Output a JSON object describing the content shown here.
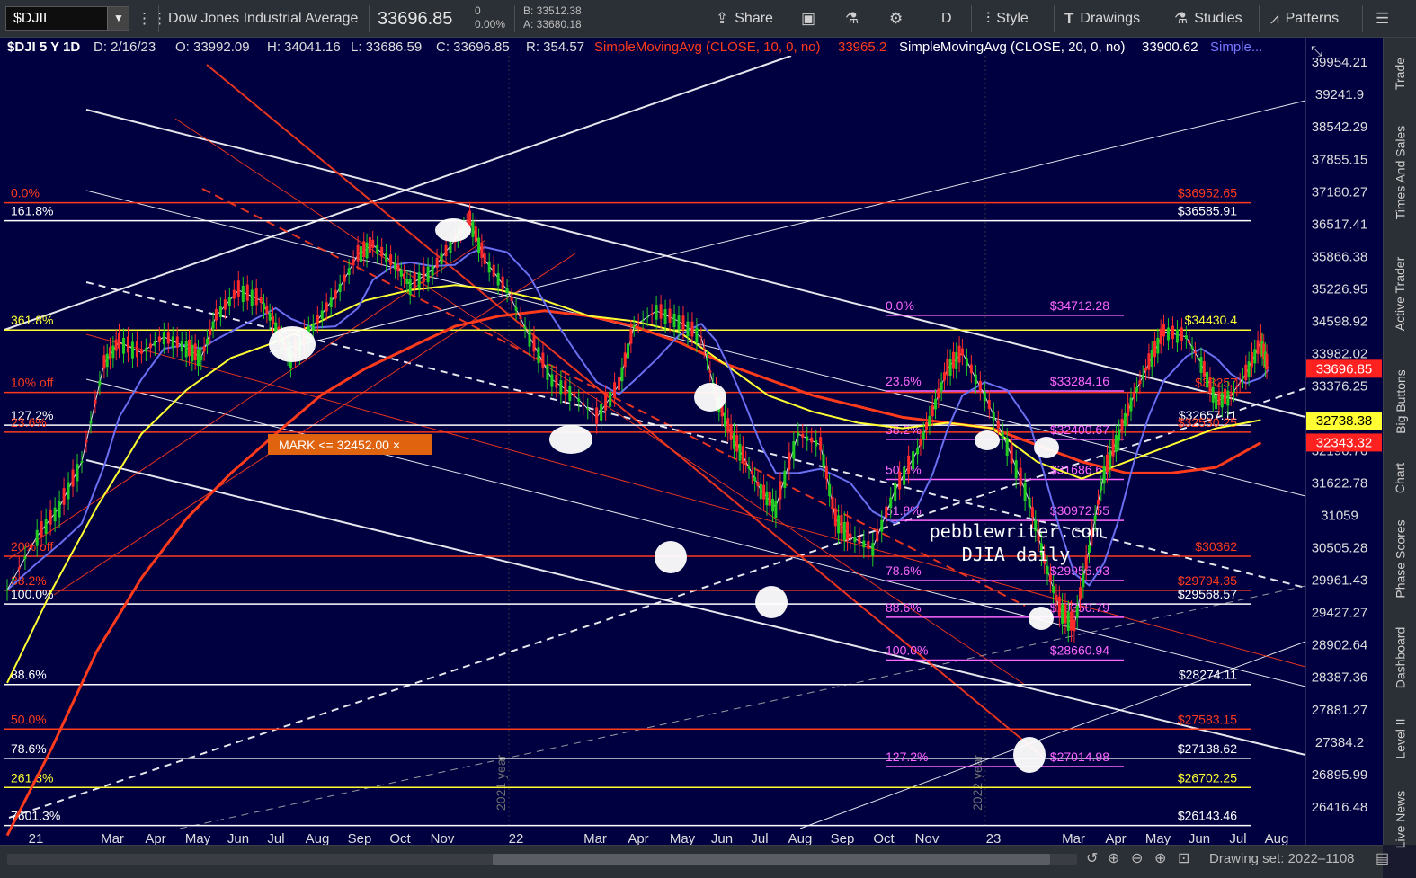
{
  "toolbar": {
    "symbol": "$DJII",
    "name": "Dow Jones Industrial Average",
    "last": "33696.85",
    "change": "0",
    "change_pct": "0.00%",
    "bid": "B: 33512.38",
    "ask": "A: 33680.18",
    "share": "Share",
    "style": "Style",
    "drawings": "Drawings",
    "studies": "Studies",
    "patterns": "Patterns",
    "period": "D"
  },
  "header": {
    "title": "$DJI 5 Y 1D",
    "date": "D: 2/16/23",
    "open": "O: 33992.09",
    "high": "H: 34041.16",
    "low": "L: 33686.59",
    "close": "C: 33696.85",
    "range": "R: 354.57",
    "sma10_label": "SimpleMovingAvg (CLOSE, 10, 0, no)",
    "sma10_value": "33965.2",
    "sma20_label": "SimpleMovingAvg (CLOSE, 20, 0, no)",
    "sma20_value": "33900.62",
    "more_label": "Simple..."
  },
  "colors": {
    "bg": "#000040",
    "red": "#ff3b1c",
    "white": "#ffffff",
    "yellow": "#ffff33",
    "magenta": "#ff66ff",
    "blue": "#6a6ef0",
    "candle_up": "#22cc22",
    "candle_down": "#ff2a2a"
  },
  "sidebar": {
    "tabs": [
      "Trade",
      "Times And Sales",
      "Active Trader",
      "Big Buttons",
      "Chart",
      "Phase Scores",
      "Dashboard",
      "Level II",
      "Live News"
    ]
  },
  "bottom": {
    "drawing_set": "Drawing set: 2022–1108"
  },
  "chart_data": {
    "type": "line",
    "title": "$DJI 5 Y 1D",
    "x_tick_labels": [
      "21",
      "Mar",
      "Apr",
      "May",
      "Jun",
      "Jul",
      "Aug",
      "Sep",
      "Oct",
      "Nov",
      "22",
      "Mar",
      "Apr",
      "May",
      "Jun",
      "Jul",
      "Aug",
      "Sep",
      "Oct",
      "Nov",
      "23",
      "Mar",
      "Apr",
      "May",
      "Jun",
      "Jul",
      "Aug"
    ],
    "year_labels": [
      "2021 year",
      "2022 year"
    ],
    "y_tick_labels": [
      "39954.21",
      "39241.9",
      "38542.29",
      "37855.15",
      "37180.27",
      "36517.41",
      "35866.38",
      "35226.95",
      "34598.92",
      "33982.02",
      "33376.25",
      "32196.76",
      "31622.78",
      "31059",
      "30505.28",
      "29961.43",
      "29427.27",
      "28902.64",
      "28387.36",
      "27881.27",
      "27384.2",
      "26895.99",
      "26416.48"
    ],
    "ylim": [
      26100,
      40500
    ],
    "y_scale": "log",
    "price_badges": [
      {
        "value": "33696.85",
        "color": "#ff2020",
        "text_color": "#ffffff"
      },
      {
        "value": "32738.38",
        "color": "#ffff33",
        "text_color": "#000000"
      },
      {
        "value": "32343.32",
        "color": "#ff2020",
        "text_color": "#ffffff"
      }
    ],
    "mark_label": "MARK <= 32452.00 ×",
    "watermark": [
      "pebblewriter.com",
      "DJIA daily"
    ],
    "horizontal_levels": [
      {
        "y": 36952.65,
        "label_left": "0.0%",
        "label_right": "$36952.65",
        "color": "#ff3b1c"
      },
      {
        "y": 36585.91,
        "label_left": "161.8%",
        "label_right": "$36585.91",
        "color": "#ffffff"
      },
      {
        "y": 34430.4,
        "label_left": "361.8%",
        "label_right": "$34430.4",
        "color": "#ffff33"
      },
      {
        "y": 33257,
        "label_left": "10% off",
        "label_right": "$33257",
        "color": "#ff3b1c"
      },
      {
        "y": 32657.11,
        "label_left": "127.2%",
        "label_right": "$32657.11",
        "color": "#ffffff"
      },
      {
        "y": 32530.25,
        "label_left": "23.6%",
        "label_right": "$32530.25",
        "color": "#ff3b1c"
      },
      {
        "y": 30362,
        "label_left": "20% off",
        "label_right": "$30362",
        "color": "#ff3b1c"
      },
      {
        "y": 29794.35,
        "label_left": "38.2%",
        "label_right": "$29794.35",
        "color": "#ff3b1c"
      },
      {
        "y": 29568.57,
        "label_left": "100.0%",
        "label_right": "$29568.57",
        "color": "#ffffff"
      },
      {
        "y": 28274.11,
        "label_left": "88.6%",
        "label_right": "$28274.11",
        "color": "#ffffff"
      },
      {
        "y": 27583.15,
        "label_left": "50.0%",
        "label_right": "$27583.15",
        "color": "#ff3b1c"
      },
      {
        "y": 27138.62,
        "label_left": "78.6%",
        "label_right": "$27138.62",
        "color": "#ffffff"
      },
      {
        "y": 26702.25,
        "label_left": "261.8%",
        "label_right": "$26702.25",
        "color": "#ffff33"
      },
      {
        "y": 26143.46,
        "label_left": "7601.3%",
        "label_right": "$26143.46",
        "color": "#ffffff"
      }
    ],
    "fib_retracement": [
      {
        "y": 34712.28,
        "label_left": "0.0%",
        "label_right": "$34712.28"
      },
      {
        "y": 33284.16,
        "label_left": "23.6%",
        "label_right": "$33284.16"
      },
      {
        "y": 32400.67,
        "label_left": "38.2%",
        "label_right": "$32400.67"
      },
      {
        "y": 31686.61,
        "label_left": "50.0%",
        "label_right": "$31686.61"
      },
      {
        "y": 30972.55,
        "label_left": "61.8%",
        "label_right": "$30972.55"
      },
      {
        "y": 29955.93,
        "label_left": "78.6%",
        "label_right": "$29955.93"
      },
      {
        "y": 29350.79,
        "label_left": "88.6%",
        "label_right": "$29350.79"
      },
      {
        "y": 28660.94,
        "label_left": "100.0%",
        "label_right": "$28660.94"
      },
      {
        "y": 27014.98,
        "label_left": "127.2%",
        "label_right": "$27014.98"
      }
    ],
    "close_points": [
      [
        0,
        29800
      ],
      [
        2,
        30700
      ],
      [
        3.5,
        31200
      ],
      [
        5,
        32000
      ],
      [
        6.5,
        33800
      ],
      [
        7.5,
        34200
      ],
      [
        9,
        34000
      ],
      [
        10.5,
        34300
      ],
      [
        12,
        34100
      ],
      [
        13,
        33900
      ],
      [
        14,
        34700
      ],
      [
        15.5,
        35200
      ],
      [
        17,
        35000
      ],
      [
        18,
        34500
      ],
      [
        19,
        33900
      ],
      [
        20.5,
        34500
      ],
      [
        22,
        35100
      ],
      [
        23.5,
        35900
      ],
      [
        24.5,
        36100
      ],
      [
        26,
        35700
      ],
      [
        27,
        35300
      ],
      [
        28.5,
        35600
      ],
      [
        30,
        36200
      ],
      [
        31,
        36600
      ],
      [
        32,
        35800
      ],
      [
        33.5,
        35200
      ],
      [
        35,
        34300
      ],
      [
        36.5,
        33500
      ],
      [
        38,
        33200
      ],
      [
        39.5,
        32800
      ],
      [
        41,
        33400
      ],
      [
        42,
        34500
      ],
      [
        43.5,
        34800
      ],
      [
        45,
        34600
      ],
      [
        46.5,
        34300
      ],
      [
        47.5,
        33200
      ],
      [
        48.5,
        32500
      ],
      [
        49.5,
        32000
      ],
      [
        50.5,
        31500
      ],
      [
        51.5,
        31200
      ],
      [
        53,
        32500
      ],
      [
        54.5,
        32300
      ],
      [
        55.5,
        31000
      ],
      [
        56.5,
        30700
      ],
      [
        58,
        30500
      ],
      [
        59.5,
        31500
      ],
      [
        61,
        32200
      ],
      [
        62,
        32900
      ],
      [
        63,
        33700
      ],
      [
        64,
        34000
      ],
      [
        65.5,
        33200
      ],
      [
        67,
        32300
      ],
      [
        68.5,
        31300
      ],
      [
        69.5,
        30300
      ],
      [
        70.5,
        29500
      ],
      [
        71.5,
        29200
      ],
      [
        72.5,
        30500
      ],
      [
        73.5,
        31800
      ],
      [
        74.5,
        32500
      ],
      [
        75.5,
        33200
      ],
      [
        76.5,
        33800
      ],
      [
        77.5,
        34400
      ],
      [
        79,
        34300
      ],
      [
        80,
        33800
      ],
      [
        81,
        33100
      ],
      [
        82,
        33200
      ],
      [
        83,
        33600
      ],
      [
        84,
        34200
      ],
      [
        84.5,
        33700
      ]
    ],
    "sma_yellow": [
      [
        0,
        28300
      ],
      [
        3,
        29800
      ],
      [
        6,
        31200
      ],
      [
        9,
        32500
      ],
      [
        12,
        33300
      ],
      [
        15,
        33900
      ],
      [
        18,
        34200
      ],
      [
        21,
        34600
      ],
      [
        24,
        35000
      ],
      [
        27,
        35200
      ],
      [
        30,
        35300
      ],
      [
        33,
        35200
      ],
      [
        36,
        35000
      ],
      [
        39,
        34700
      ],
      [
        42,
        34600
      ],
      [
        45,
        34400
      ],
      [
        48,
        33800
      ],
      [
        51,
        33200
      ],
      [
        54,
        32900
      ],
      [
        57,
        32700
      ],
      [
        60,
        32600
      ],
      [
        63,
        32700
      ],
      [
        66,
        32600
      ],
      [
        69,
        32000
      ],
      [
        72,
        31700
      ],
      [
        75,
        32000
      ],
      [
        78,
        32300
      ],
      [
        81,
        32600
      ],
      [
        84,
        32750
      ]
    ],
    "sma_red": [
      [
        0,
        26000
      ],
      [
        3,
        27300
      ],
      [
        6,
        28800
      ],
      [
        9,
        30000
      ],
      [
        12,
        31000
      ],
      [
        15,
        31800
      ],
      [
        18,
        32500
      ],
      [
        21,
        33200
      ],
      [
        24,
        33700
      ],
      [
        27,
        34100
      ],
      [
        30,
        34500
      ],
      [
        33,
        34700
      ],
      [
        36,
        34800
      ],
      [
        39,
        34700
      ],
      [
        42,
        34500
      ],
      [
        45,
        34200
      ],
      [
        48,
        33800
      ],
      [
        51,
        33500
      ],
      [
        54,
        33200
      ],
      [
        57,
        33000
      ],
      [
        60,
        32800
      ],
      [
        63,
        32700
      ],
      [
        66,
        32600
      ],
      [
        69,
        32300
      ],
      [
        72,
        32000
      ],
      [
        75,
        31800
      ],
      [
        78,
        31800
      ],
      [
        81,
        31900
      ],
      [
        84,
        32340
      ]
    ]
  }
}
